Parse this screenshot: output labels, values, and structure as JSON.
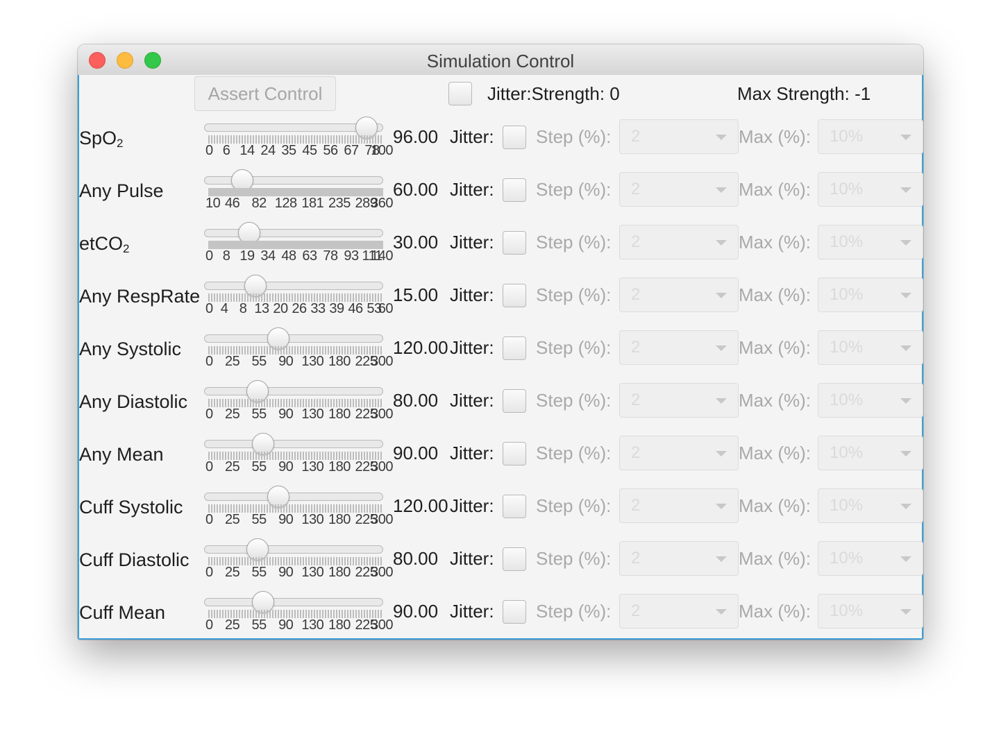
{
  "window": {
    "title": "Simulation Control"
  },
  "header": {
    "assert_label": "Assert Control",
    "jitter_strength": "Jitter:Strength: 0",
    "max_strength": "Max Strength: -1"
  },
  "labels": {
    "jitter": "Jitter:",
    "step": "Step (%):",
    "max": "Max (%):",
    "step_value": "2",
    "max_value": "10%"
  },
  "rows": [
    {
      "name": "SpO",
      "sub": "2",
      "value": "96.00",
      "level": 0.96,
      "dense": false,
      "ticks": [
        "0",
        "6",
        "14",
        "24",
        "35",
        "45",
        "56",
        "67",
        "78",
        "100"
      ]
    },
    {
      "name": "Any Pulse",
      "sub": "",
      "value": "60.00",
      "level": 0.1667,
      "dense": true,
      "ticks": [
        "10",
        "46",
        "82",
        "128",
        "181",
        "235",
        "289",
        "360"
      ]
    },
    {
      "name": "etCO",
      "sub": "2",
      "value": "30.00",
      "level": 0.2143,
      "dense": true,
      "ticks": [
        "0",
        "8",
        "19",
        "34",
        "48",
        "63",
        "78",
        "93",
        "111",
        "140"
      ]
    },
    {
      "name": "Any RespRate",
      "sub": "",
      "value": "15.00",
      "level": 0.25,
      "dense": false,
      "ticks": [
        "0",
        "4",
        "8",
        "13",
        "20",
        "26",
        "33",
        "39",
        "46",
        "53",
        "60"
      ]
    },
    {
      "name": "Any Systolic",
      "sub": "",
      "value": "120.00",
      "level": 0.4,
      "dense": false,
      "ticks": [
        "0",
        "25",
        "55",
        "90",
        "130",
        "180",
        "225",
        "300"
      ]
    },
    {
      "name": "Any Diastolic",
      "sub": "",
      "value": "80.00",
      "level": 0.2667,
      "dense": false,
      "ticks": [
        "0",
        "25",
        "55",
        "90",
        "130",
        "180",
        "225",
        "300"
      ]
    },
    {
      "name": "Any Mean",
      "sub": "",
      "value": "90.00",
      "level": 0.3,
      "dense": false,
      "ticks": [
        "0",
        "25",
        "55",
        "90",
        "130",
        "180",
        "225",
        "300"
      ]
    },
    {
      "name": "Cuff Systolic",
      "sub": "",
      "value": "120.00",
      "level": 0.4,
      "dense": false,
      "ticks": [
        "0",
        "25",
        "55",
        "90",
        "130",
        "180",
        "225",
        "300"
      ]
    },
    {
      "name": "Cuff Diastolic",
      "sub": "",
      "value": "80.00",
      "level": 0.2667,
      "dense": false,
      "ticks": [
        "0",
        "25",
        "55",
        "90",
        "130",
        "180",
        "225",
        "300"
      ]
    },
    {
      "name": "Cuff Mean",
      "sub": "",
      "value": "90.00",
      "level": 0.3,
      "dense": false,
      "ticks": [
        "0",
        "25",
        "55",
        "90",
        "130",
        "180",
        "225",
        "300"
      ]
    }
  ]
}
